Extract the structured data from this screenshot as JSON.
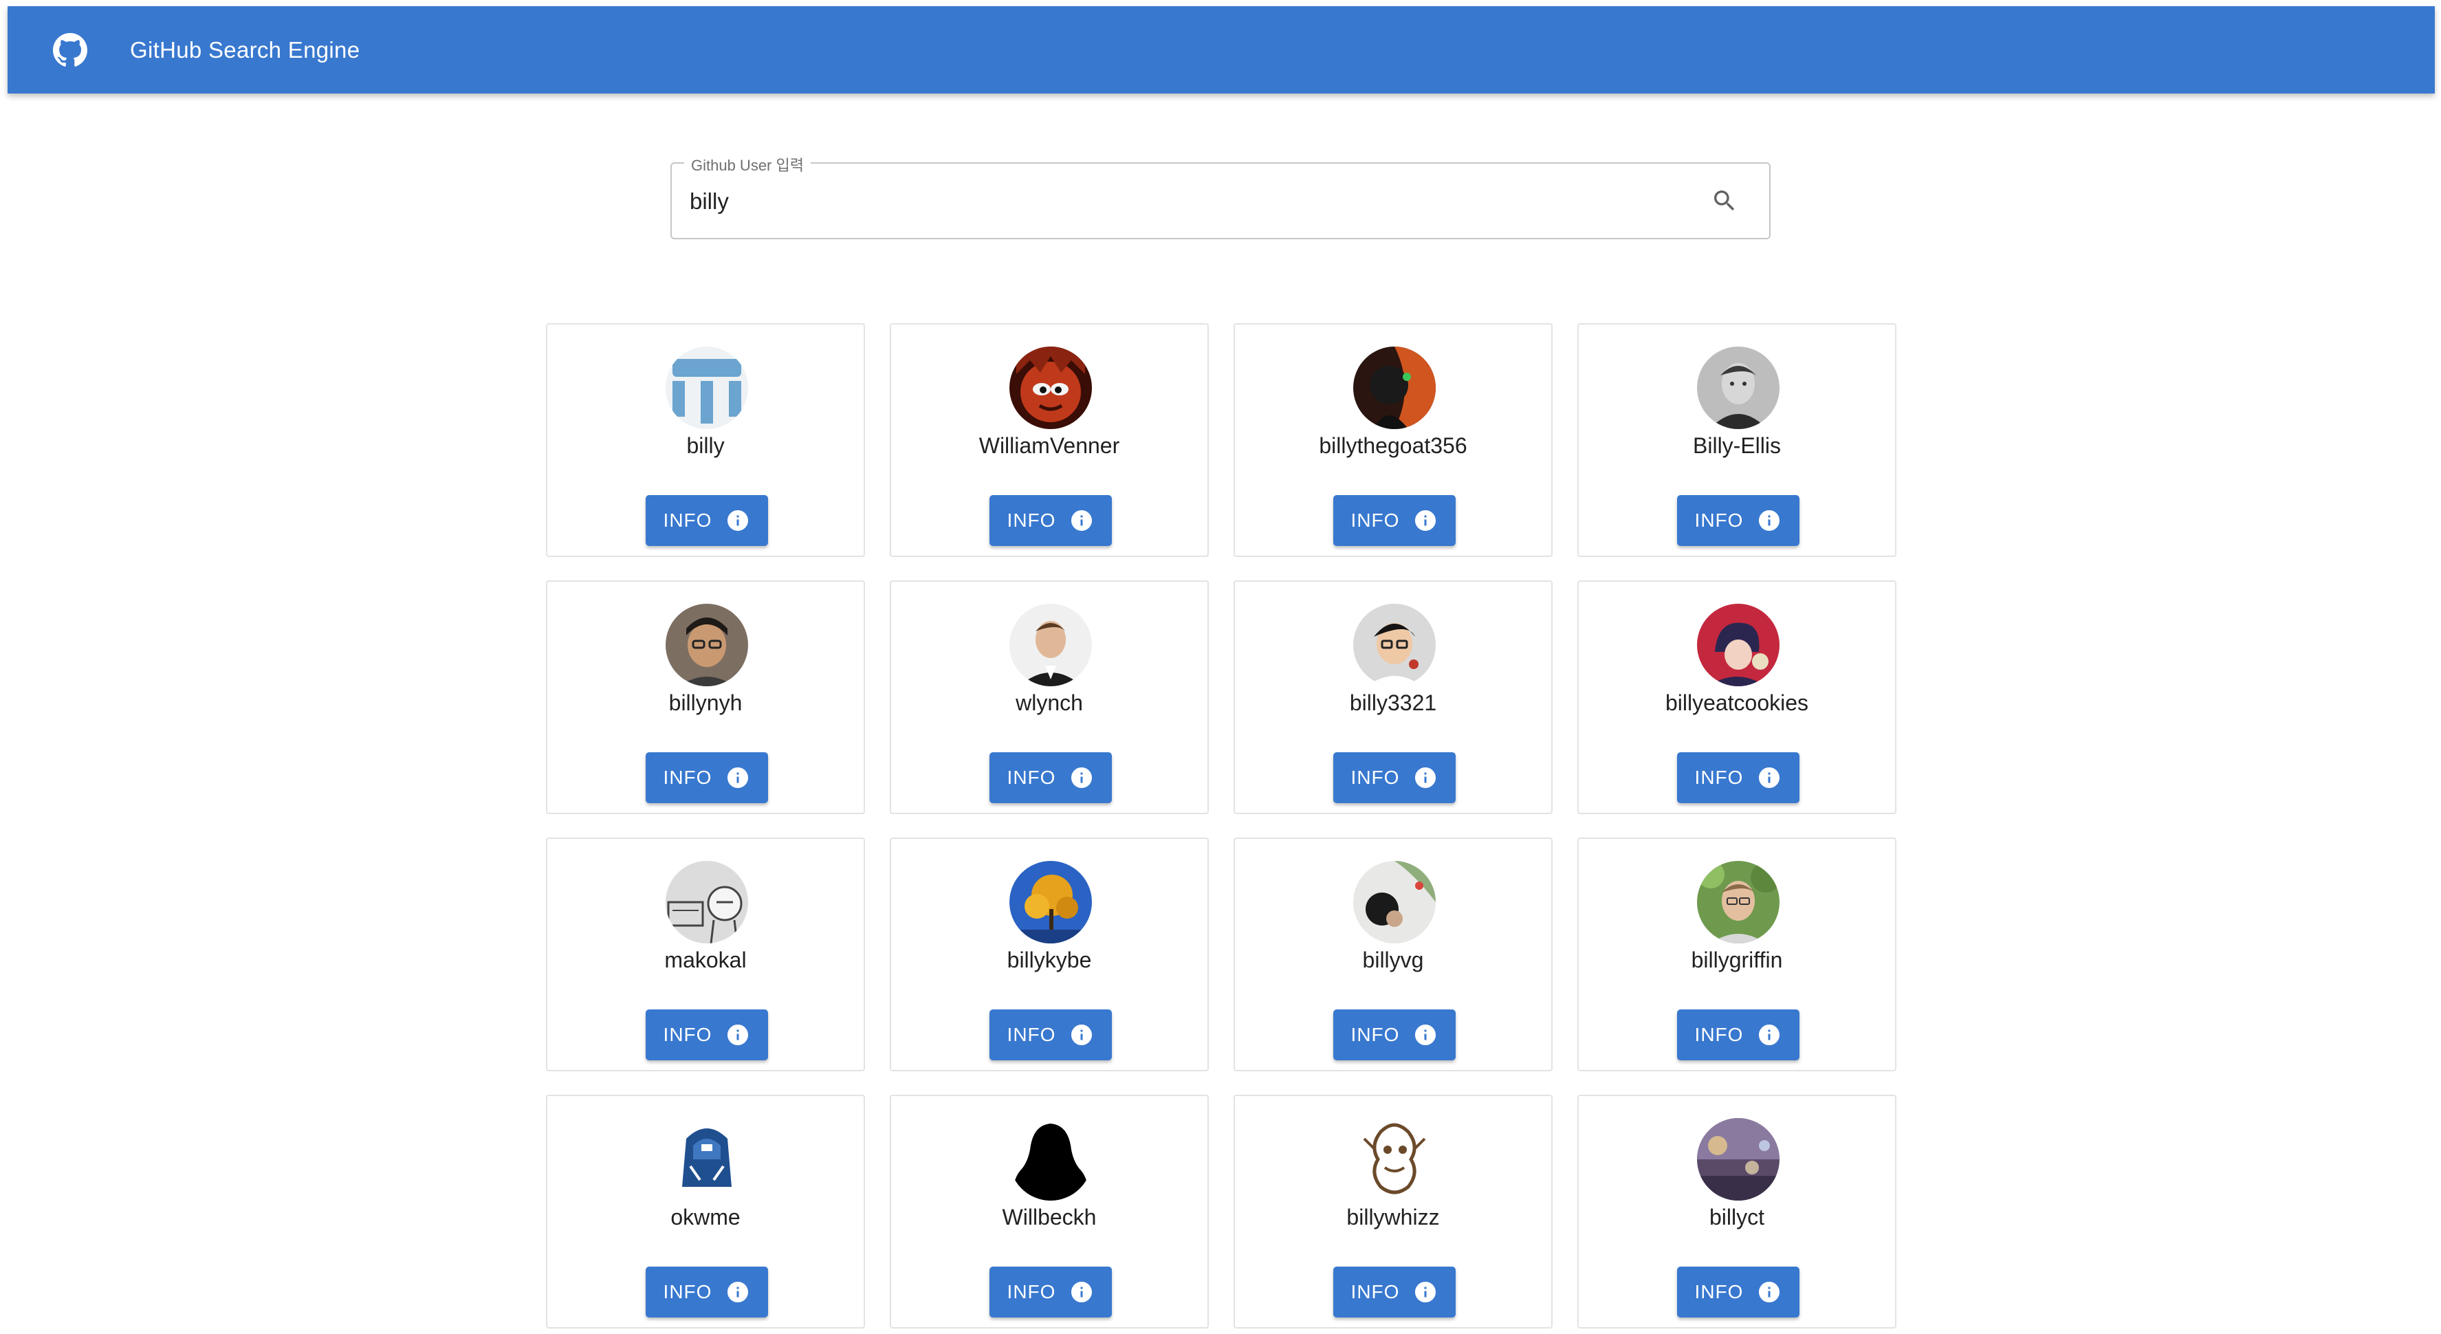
{
  "appbar": {
    "title": "GitHub Search Engine",
    "logo_icon": "github-icon",
    "color": "#3878cf"
  },
  "search": {
    "label": "Github User 입력",
    "value": "billy",
    "icon": "search-icon"
  },
  "results": [
    {
      "username": "billy",
      "button_label": "INFO"
    },
    {
      "username": "WilliamVenner",
      "button_label": "INFO"
    },
    {
      "username": "billythegoat356",
      "button_label": "INFO"
    },
    {
      "username": "Billy-Ellis",
      "button_label": "INFO"
    },
    {
      "username": "billynyh",
      "button_label": "INFO"
    },
    {
      "username": "wlynch",
      "button_label": "INFO"
    },
    {
      "username": "billy3321",
      "button_label": "INFO"
    },
    {
      "username": "billyeatcookies",
      "button_label": "INFO"
    },
    {
      "username": "makokal",
      "button_label": "INFO"
    },
    {
      "username": "billykybe",
      "button_label": "INFO"
    },
    {
      "username": "billyvg",
      "button_label": "INFO"
    },
    {
      "username": "billygriffin",
      "button_label": "INFO"
    },
    {
      "username": "okwme",
      "button_label": "INFO"
    },
    {
      "username": "Willbeckh",
      "button_label": "INFO"
    },
    {
      "username": "billywhizz",
      "button_label": "INFO"
    },
    {
      "username": "billyct",
      "button_label": "INFO"
    }
  ]
}
